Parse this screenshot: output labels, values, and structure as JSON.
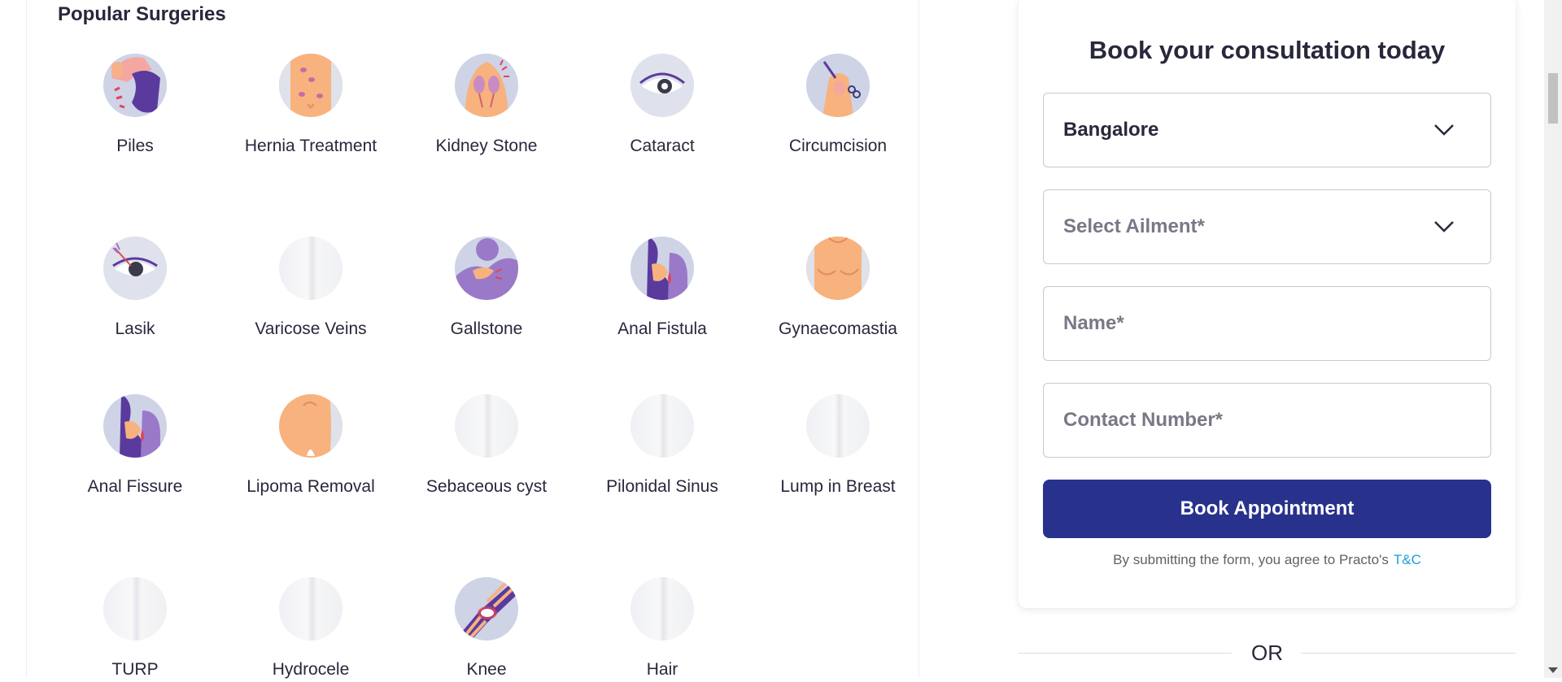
{
  "section": {
    "title": "Popular Surgeries"
  },
  "surgeries": [
    {
      "label": "Piles",
      "icon": "piles-icon"
    },
    {
      "label": "Hernia Treatment",
      "icon": "hernia-icon"
    },
    {
      "label": "Kidney Stone",
      "icon": "kidney-stone-icon"
    },
    {
      "label": "Cataract",
      "icon": "cataract-icon"
    },
    {
      "label": "Circumcision",
      "icon": "circumcision-icon"
    },
    {
      "label": "Lasik",
      "icon": "lasik-icon"
    },
    {
      "label": "Varicose Veins",
      "icon": "placeholder-icon"
    },
    {
      "label": "Gallstone",
      "icon": "gallstone-icon"
    },
    {
      "label": "Anal Fistula",
      "icon": "anal-fistula-icon"
    },
    {
      "label": "Gynaecomastia",
      "icon": "gynaecomastia-icon"
    },
    {
      "label": "Anal Fissure",
      "icon": "anal-fissure-icon"
    },
    {
      "label": "Lipoma Removal",
      "icon": "lipoma-icon"
    },
    {
      "label": "Sebaceous cyst",
      "icon": "placeholder-icon"
    },
    {
      "label": "Pilonidal Sinus",
      "icon": "placeholder-icon"
    },
    {
      "label": "Lump in Breast",
      "icon": "placeholder-icon"
    },
    {
      "label": "TURP",
      "icon": "placeholder-icon"
    },
    {
      "label": "Hydrocele",
      "icon": "placeholder-icon"
    },
    {
      "label": "Knee",
      "icon": "knee-icon"
    },
    {
      "label": "Hair",
      "icon": "placeholder-icon"
    }
  ],
  "booking": {
    "title": "Book your consultation today",
    "city": {
      "value": "Bangalore",
      "icon": "chevron-down-icon"
    },
    "ailment": {
      "placeholder": "Select Ailment*",
      "icon": "chevron-down-icon"
    },
    "name": {
      "placeholder": "Name*"
    },
    "contact": {
      "placeholder": "Contact Number*"
    },
    "submit_label": "Book Appointment",
    "terms_text": "By submitting the form, you agree to Practo's",
    "terms_link": "T&C",
    "brand_color": "#28328c",
    "link_color": "#199fd9"
  },
  "divider": {
    "label": "OR"
  }
}
